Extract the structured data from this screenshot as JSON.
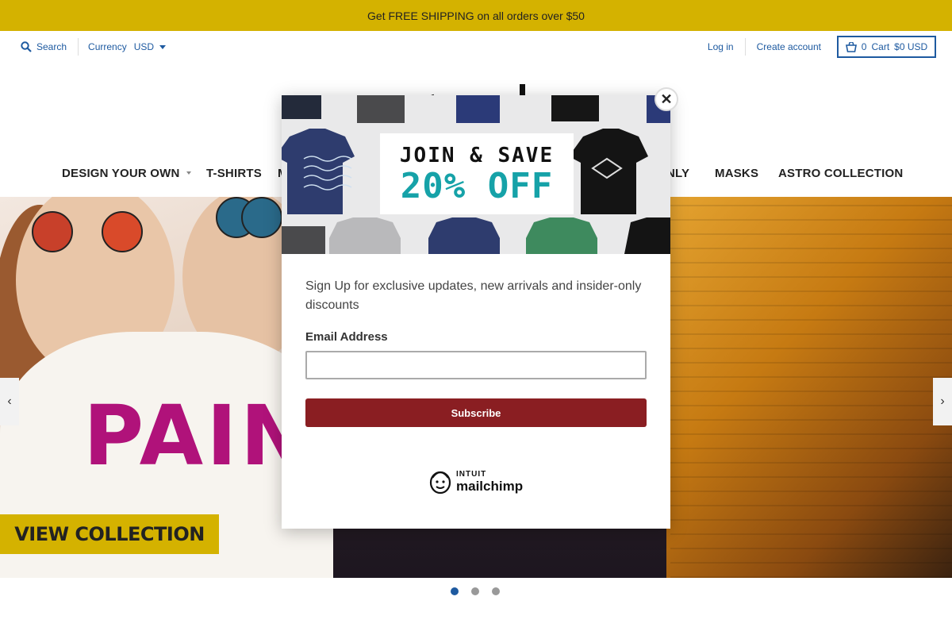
{
  "announcement": {
    "text": "Get FREE SHIPPING on all orders over $50"
  },
  "utility": {
    "search_label": "Search",
    "currency_label": "Currency",
    "currency_value": "USD",
    "login_label": "Log in",
    "create_account_label": "Create account",
    "cart_count": "0",
    "cart_label": "Cart",
    "cart_total": "$0 USD"
  },
  "nav": {
    "items": [
      {
        "label": "DESIGN YOUR OWN",
        "has_dropdown": true
      },
      {
        "label": "T-SHIRTS"
      },
      {
        "label": "M"
      },
      {
        "label": "NLY"
      },
      {
        "label": "MASKS"
      },
      {
        "label": "ASTRO COLLECTION"
      }
    ]
  },
  "hero": {
    "headline": "PAINT",
    "cta_label": "VIEW COLLECTION",
    "prev_arrow": "‹",
    "next_arrow": "›",
    "slides": 3,
    "active_slide": 1
  },
  "popup": {
    "banner_line1": "JOIN & SAVE",
    "banner_line2": "20% OFF",
    "close_symbol": "✕",
    "body_text": "Sign Up for exclusive updates, new arrivals and insider-only discounts",
    "email_label": "Email Address",
    "email_value": "",
    "subscribe_label": "Subscribe",
    "brand_line1": "INTUIT",
    "brand_line2": "mailchimp"
  },
  "colors": {
    "accent": "#d4b200",
    "link": "#1e5aa0",
    "subscribe": "#8a1e22",
    "promo_teal": "#16a2a8",
    "paint_magenta": "#b0127a"
  },
  "icons": {
    "search": "search-icon",
    "cart": "cart-icon",
    "close": "close-icon",
    "prev": "chevron-left-icon",
    "next": "chevron-right-icon",
    "mailchimp": "mailchimp-freddie-icon"
  }
}
